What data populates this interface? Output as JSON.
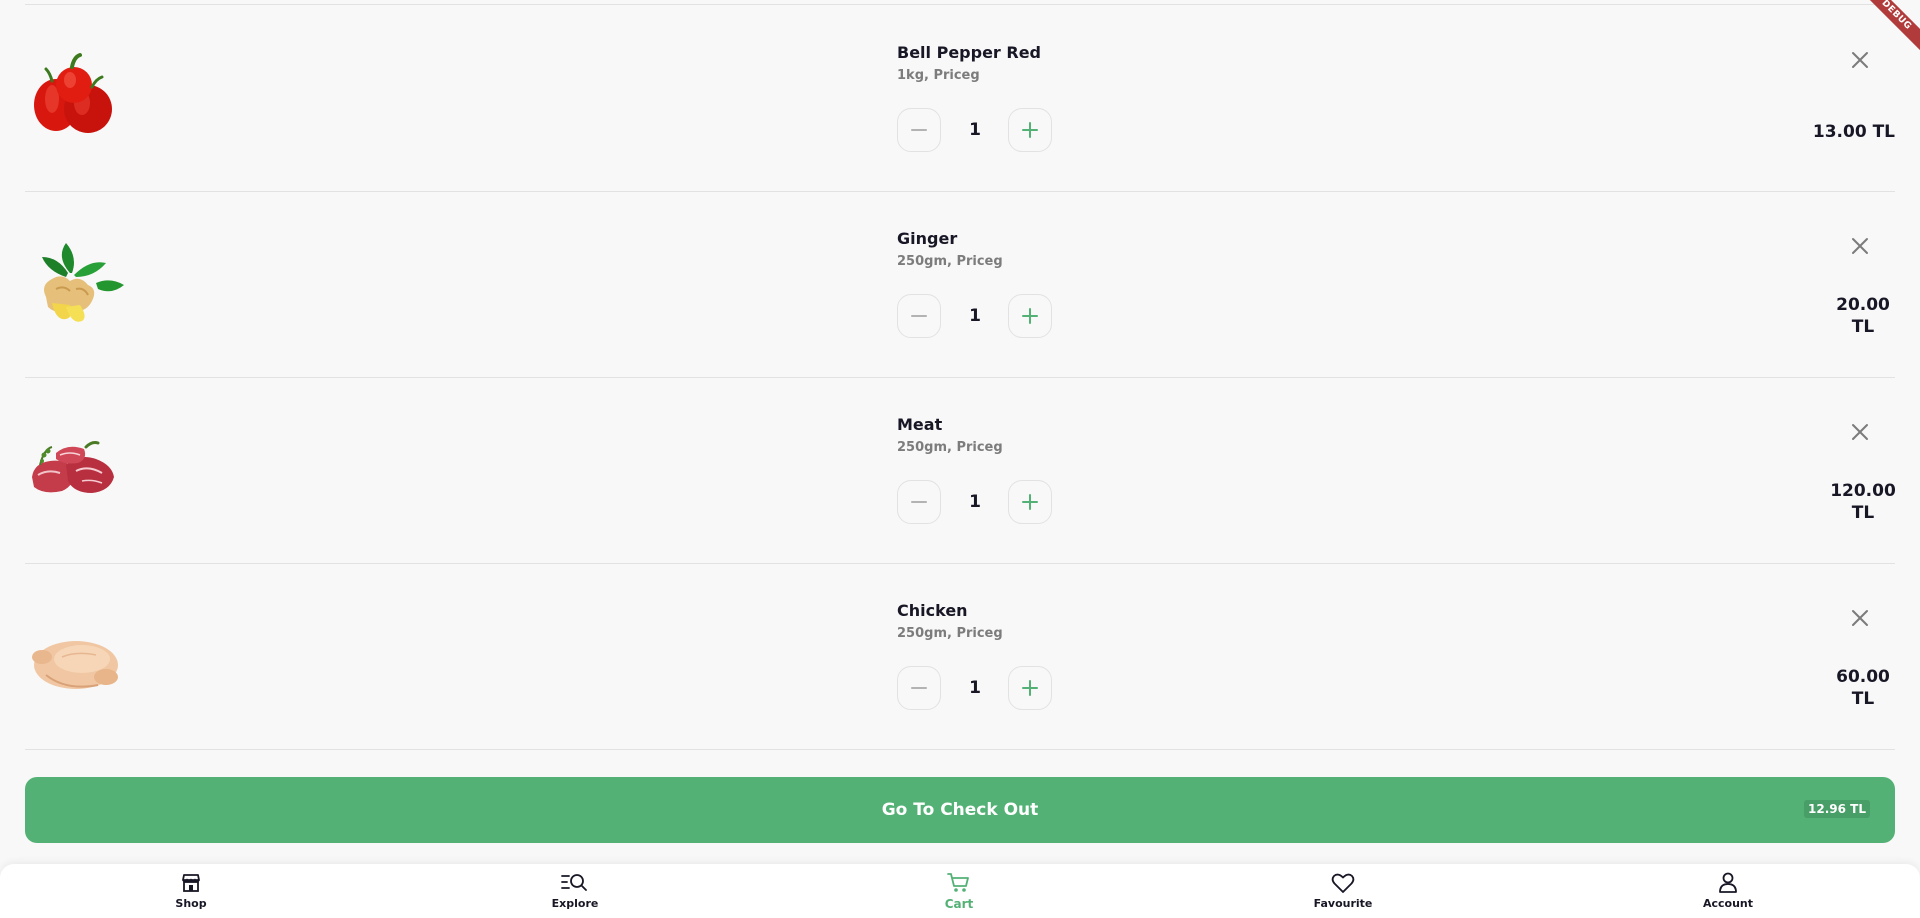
{
  "cart": {
    "items": [
      {
        "name": "Bell Pepper Red",
        "subtitle": "1kg, Priceg",
        "quantity": "1",
        "price": "13.00 TL",
        "image_icon": "bell-pepper-image"
      },
      {
        "name": "Ginger",
        "subtitle": "250gm, Priceg",
        "quantity": "1",
        "price": "20.00 TL",
        "image_icon": "ginger-image"
      },
      {
        "name": "Meat",
        "subtitle": "250gm, Priceg",
        "quantity": "1",
        "price": "120.00 TL",
        "image_icon": "meat-image"
      },
      {
        "name": "Chicken",
        "subtitle": "250gm, Priceg",
        "quantity": "1",
        "price": "60.00 TL",
        "image_icon": "chicken-image"
      }
    ]
  },
  "checkout": {
    "label": "Go To Check Out",
    "total": "12.96 TL"
  },
  "nav": {
    "items": [
      {
        "label": "Shop",
        "icon": "shop-icon"
      },
      {
        "label": "Explore",
        "icon": "explore-icon"
      },
      {
        "label": "Cart",
        "icon": "cart-icon",
        "active": true
      },
      {
        "label": "Favourite",
        "icon": "heart-icon"
      },
      {
        "label": "Account",
        "icon": "account-icon"
      }
    ]
  },
  "debug": {
    "label": "DEBUG"
  },
  "colors": {
    "accent": "#53b175",
    "text": "#181725",
    "muted": "#7c7c7c",
    "divider": "#e2e2e2",
    "background": "#f8f8f8"
  }
}
